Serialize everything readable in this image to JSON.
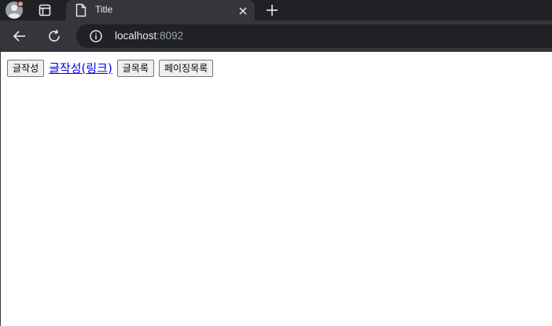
{
  "browser": {
    "tab": {
      "title": "Title"
    },
    "address": {
      "host": "localhost",
      "port": ":8092"
    },
    "icons": {
      "profile": "profile-avatar-icon",
      "tab_search": "tab-grid-icon",
      "favicon": "page-icon",
      "close": "close-icon",
      "new_tab": "plus-icon",
      "back": "arrow-left-icon",
      "reload": "reload-icon",
      "site_info": "info-icon"
    },
    "colors": {
      "tabstrip": "#202124",
      "toolbar": "#35363a",
      "profile_badge": "#f28b82"
    }
  },
  "page": {
    "write_button_label": "글작성",
    "write_link_label": "글작성(링크)",
    "list_button_label": "글목록",
    "paging_list_button_label": "페이징목록",
    "link_color": "#0000ee"
  }
}
